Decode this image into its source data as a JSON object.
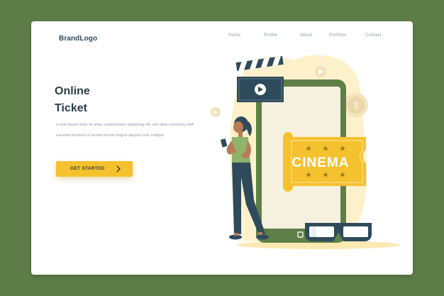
{
  "brand": {
    "logo_text": "BrandLogo"
  },
  "nav": {
    "items": [
      {
        "label": "Home"
      },
      {
        "label": "Profile"
      },
      {
        "label": "About"
      },
      {
        "label": "Portfolio"
      },
      {
        "label": "Contact"
      }
    ]
  },
  "hero": {
    "title_line1": "Online",
    "title_line2": "Ticket",
    "description": "Lorem ipsum dolor sit amet, consectetuer adipiscing elit, sed diam nonummy nibh euismod tincidunt ut laoreet dolore magna aliquam erat volutpat",
    "cta_label": "GET STARTED"
  },
  "illustration": {
    "ticket_text": "CINEMA",
    "colors": {
      "background": "#5e7e49",
      "accent_yellow": "#f5c12f",
      "phone_frame": "#5f7f49",
      "dark_navy": "#2f4b5b",
      "blob_cream": "#fdf1cc"
    },
    "icons": [
      "clapperboard-icon",
      "play-icon",
      "dollar-coin-icon",
      "cinema-ticket",
      "3d-glasses-icon",
      "woman-with-phone-figure"
    ]
  }
}
